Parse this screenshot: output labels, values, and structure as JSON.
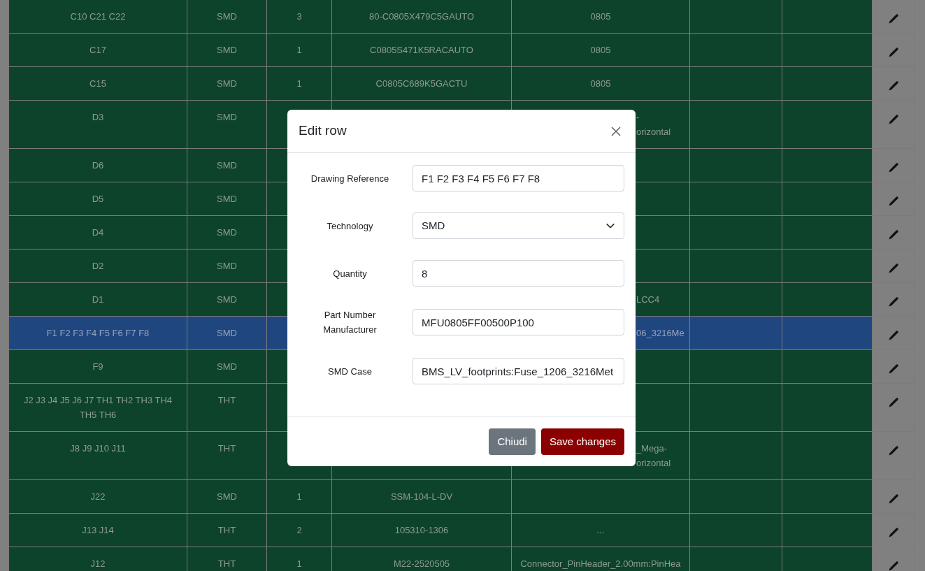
{
  "table": {
    "rows": [
      {
        "reference": "C10 C21 C22",
        "technology": "SMD",
        "quantity": "3",
        "part_number": "80-C0805X479C5GAUTO",
        "case": [
          "0805"
        ],
        "case_cut": false,
        "selected": false
      },
      {
        "reference": "C17",
        "technology": "SMD",
        "quantity": "1",
        "part_number": "C0805S471K5RACAUTO",
        "case": [
          "0805"
        ],
        "case_cut": false,
        "selected": false
      },
      {
        "reference": "C15",
        "technology": "SMD",
        "quantity": "1",
        "part_number": "C0805C689K5GACTU",
        "case": [
          "0805"
        ],
        "case_cut": false,
        "selected": false
      },
      {
        "reference": "D3",
        "technology": "SMD",
        "case": [
          "-",
          "orizontal"
        ],
        "case_cut": true,
        "selected": false
      },
      {
        "reference": "D6",
        "technology": "SMD",
        "selected": false
      },
      {
        "reference": "D5",
        "technology": "SMD",
        "selected": false
      },
      {
        "reference": "D4",
        "technology": "SMD",
        "selected": false
      },
      {
        "reference": "D2",
        "technology": "SMD",
        "selected": false
      },
      {
        "reference": "D1",
        "technology": "SMD",
        "case": [
          "LCC4"
        ],
        "case_cut": true,
        "selected": false
      },
      {
        "reference": "F1 F2 F3 F4 F5 F6 F7 F8",
        "technology": "SMD",
        "case": [
          "06_3216Me"
        ],
        "case_cut": true,
        "selected": true
      },
      {
        "reference": "F9",
        "technology": "SMD",
        "selected": false
      },
      {
        "reference": "J2 J3 J4 J5 J6 J7 TH1 TH2 TH3 TH4 TH5 TH6",
        "technology": "THT",
        "selected": false
      },
      {
        "reference": "J8 J9 J10 J11",
        "technology": "THT",
        "case": [
          "_Mega-",
          "orizontal"
        ],
        "case_cut": true,
        "selected": false
      },
      {
        "reference": "J22",
        "technology": "SMD",
        "quantity": "1",
        "part_number": "SSM-104-L-DV",
        "selected": false
      },
      {
        "reference": "J13 J14",
        "technology": "THT",
        "quantity": "2",
        "part_number": "105310-1306",
        "case": [
          "..."
        ],
        "case_cut": false,
        "selected": false
      },
      {
        "reference": "J12",
        "technology": "THT",
        "quantity": "1",
        "part_number": "M22-2520505",
        "case": [
          "Connector_PinHeader_2.00mm:PinHea"
        ],
        "case_cut": false,
        "selected": false
      }
    ]
  },
  "modal": {
    "title": "Edit row",
    "fields": [
      {
        "label": "Drawing Reference",
        "kind": "text",
        "value": "F1 F2 F3 F4 F5 F6 F7 F8"
      },
      {
        "label": "Technology",
        "kind": "select",
        "value": "SMD"
      },
      {
        "label": "Quantity",
        "kind": "text",
        "value": "8"
      },
      {
        "label": "Part Number Manufacturer",
        "kind": "text",
        "value": "MFU0805FF00500P100"
      },
      {
        "label": "SMD Case",
        "kind": "text",
        "value": "BMS_LV_footprints:Fuse_1206_3216Met"
      }
    ],
    "buttons": [
      {
        "label": "Chiudi",
        "kind": "secondary"
      },
      {
        "label": "Save changes",
        "kind": "primary"
      }
    ]
  }
}
